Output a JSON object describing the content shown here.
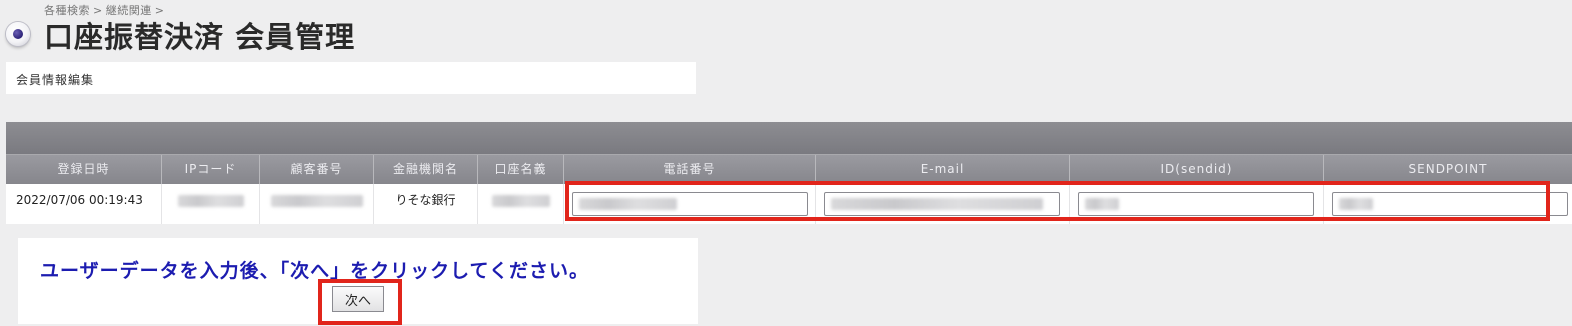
{
  "header": {
    "breadcrumb": [
      "各種検索",
      "継続関連"
    ],
    "breadcrumb_separator": ">",
    "title": "口座振替決済 会員管理"
  },
  "section": {
    "label": "会員情報編集"
  },
  "table": {
    "columns": [
      "登録日時",
      "IPコード",
      "顧客番号",
      "金融機関名",
      "口座名義",
      "電話番号",
      "E-mail",
      "ID(sendid)",
      "SENDPOINT"
    ],
    "row": {
      "registered_at": "2022/07/06 00:19:43",
      "ip_code": "",
      "customer_number": "",
      "bank_name": "りそな銀行",
      "account_holder": "",
      "phone": "",
      "email": "",
      "sendid": "",
      "sendpoint": ""
    }
  },
  "instruction": {
    "text": "ユーザーデータを入力後、「次へ」をクリックしてください。",
    "next_button_label": "次へ"
  },
  "colors": {
    "highlight": "#e1251b",
    "instruction_text": "#1c1cb0",
    "table_header": "#8d8d92"
  },
  "icons": {
    "title_bullet": "radio-bullet-icon"
  }
}
